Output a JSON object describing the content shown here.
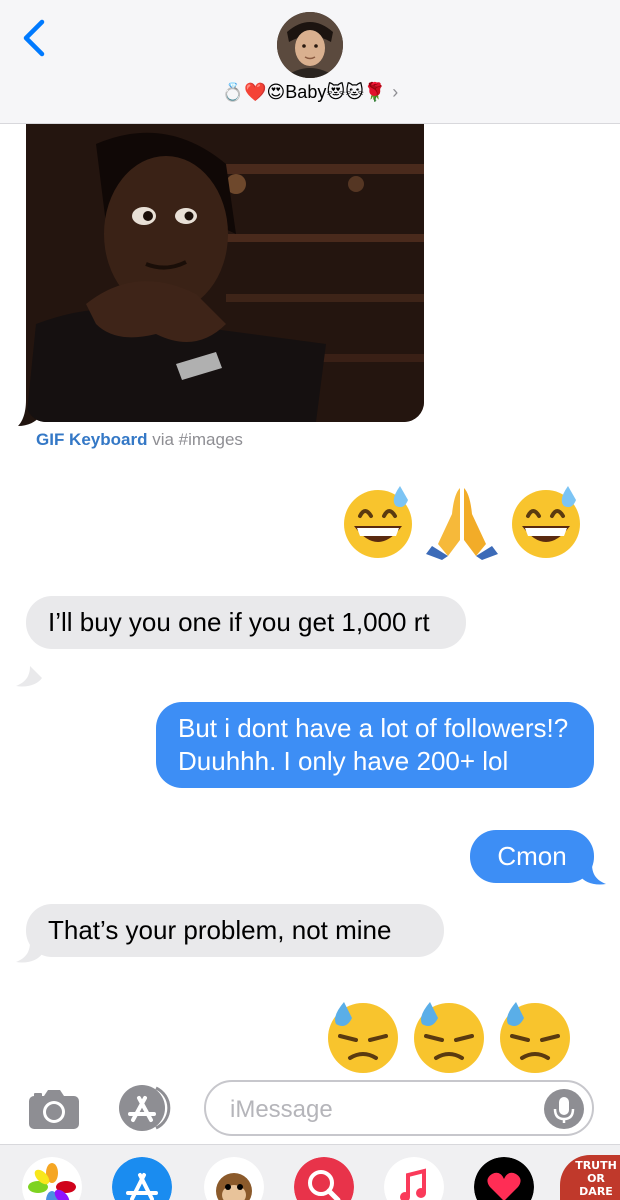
{
  "header": {
    "contact_name": "Baby",
    "emoji_before": "💍❤️😍",
    "emoji_after": "😻🐱🌹",
    "chevron": "›"
  },
  "gif": {
    "app_name": "GIF Keyboard",
    "via_text": "via #images"
  },
  "messages": [
    {
      "direction": "incoming",
      "text": "I’ll buy you one if you get 1,000 rt"
    },
    {
      "direction": "outgoing",
      "text": "But i dont have a lot of followers!? Duuhhh. I only have 200+ lol"
    },
    {
      "direction": "outgoing",
      "text": "Cmon"
    },
    {
      "direction": "incoming",
      "text": "That’s your problem, not mine"
    }
  ],
  "emoji_messages": [
    {
      "icons": [
        "grinning-sweat-emoji",
        "folded-hands-emoji",
        "grinning-sweat-emoji"
      ]
    },
    {
      "icons": [
        "downcast-sweat-emoji",
        "downcast-sweat-emoji",
        "downcast-sweat-emoji"
      ]
    }
  ],
  "input": {
    "placeholder": "iMessage"
  },
  "drawer": {
    "apps": [
      "photos-icon",
      "app-store-icon",
      "animoji-icon",
      "search-images-icon",
      "music-icon",
      "digital-touch-icon",
      "truth-or-dare-icon"
    ],
    "truth_or_dare_label": "TRUTH OR DARE"
  },
  "colors": {
    "outgoing_bubble": "#3d8ef5",
    "incoming_bubble": "#e9e9eb",
    "accent": "#007aff"
  }
}
